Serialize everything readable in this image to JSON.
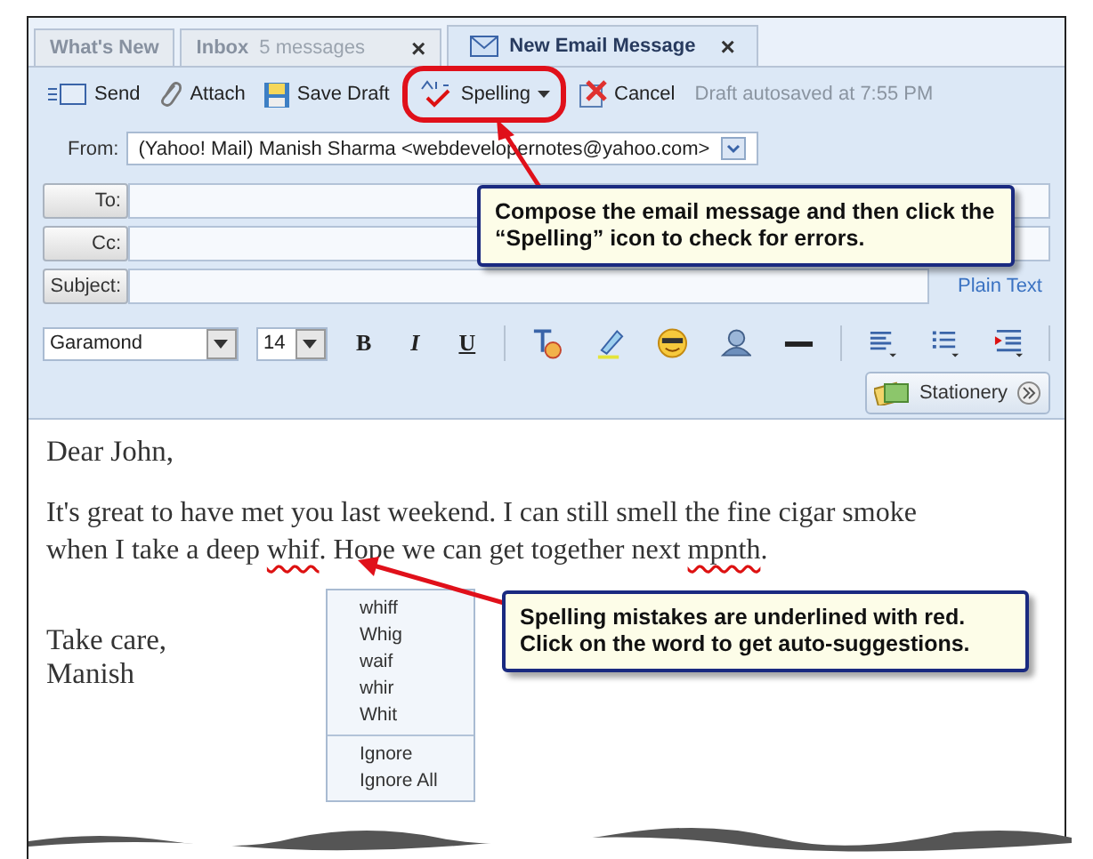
{
  "tabs": [
    {
      "label": "What's New",
      "selected": false
    },
    {
      "label": "Inbox",
      "count": "5 messages",
      "selected": false,
      "close": "×"
    },
    {
      "label": "New Email Message",
      "selected": true,
      "close": "×"
    }
  ],
  "toolbar": {
    "buttons": [
      {
        "label": "Send"
      },
      {
        "label": "Attach"
      },
      {
        "label": "Save Draft"
      },
      {
        "label": "Spelling",
        "highlighted": true,
        "dropdown": true
      },
      {
        "label": "Cancel"
      }
    ],
    "status": "Draft autosaved at 7:55 PM"
  },
  "header": {
    "from_label": "From:",
    "from_value": "(Yahoo! Mail) Manish Sharma <webdevelopernotes@yahoo.com>",
    "fields": [
      {
        "label": "To:"
      },
      {
        "label": "Cc:"
      },
      {
        "label": "Subject:"
      }
    ],
    "plain_text_link": "Plain Text"
  },
  "format": {
    "font": "Garamond",
    "size": "14",
    "styles": [
      "B",
      "I",
      "U"
    ]
  },
  "stationery": "Stationery",
  "body": {
    "greeting": "Dear John,",
    "paragraph": [
      {
        "text": "It's great to have met you last weekend. I can still smell the fine cigar smoke when I take a deep "
      },
      {
        "text": "whif",
        "misspelled": true
      },
      {
        "text": ". Hope we can get together next "
      },
      {
        "text": "mpnth",
        "misspelled": true
      },
      {
        "text": "."
      }
    ],
    "closing": [
      "Take care,",
      "Manish"
    ]
  },
  "spell_menu": {
    "suggestions": [
      "whiff",
      "Whig",
      "waif",
      "whir",
      "Whit"
    ],
    "actions": [
      "Ignore",
      "Ignore All"
    ]
  },
  "annotations": [
    "Compose the email message and then click the “Spelling” icon to check for errors.",
    "Spelling mistakes are underlined with red. Click on the word to get auto-suggestions."
  ]
}
